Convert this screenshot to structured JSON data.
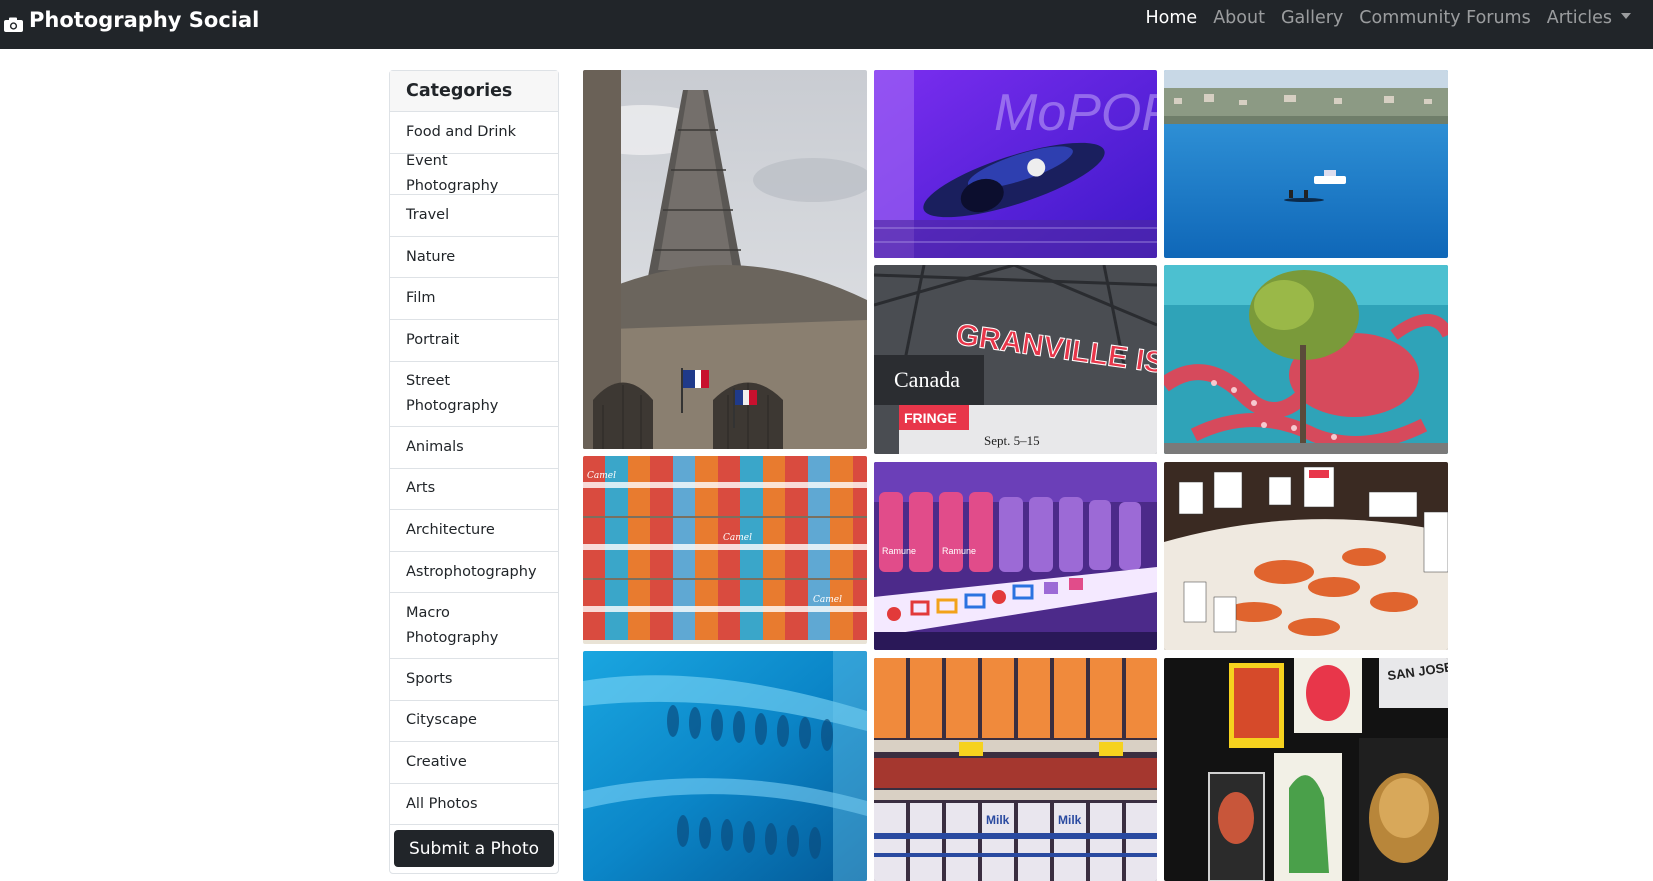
{
  "navbar": {
    "brand": "Photography Social",
    "brand_icon": "camera-icon",
    "links": [
      {
        "label": "Home",
        "active": true
      },
      {
        "label": "About"
      },
      {
        "label": "Gallery"
      },
      {
        "label": "Community Forums"
      },
      {
        "label": "Articles",
        "dropdown": true
      }
    ]
  },
  "sidebar": {
    "title": "Categories",
    "items": [
      {
        "label": "Food and Drink"
      },
      {
        "label": "Event Photography"
      },
      {
        "label": "Travel"
      },
      {
        "label": "Nature"
      },
      {
        "label": "Film"
      },
      {
        "label": "Portrait"
      },
      {
        "label": "Street\nPhotography"
      },
      {
        "label": "Animals"
      },
      {
        "label": "Arts"
      },
      {
        "label": "Architecture"
      },
      {
        "label": "Astrophotography"
      },
      {
        "label": "Macro\nPhotography"
      },
      {
        "label": "Sports"
      },
      {
        "label": "Cityscape"
      },
      {
        "label": "Creative"
      },
      {
        "label": "All Photos"
      }
    ],
    "submit_label": "Submit a Photo"
  },
  "gallery": {
    "photos": [
      {
        "name": "eiffel-tower-photo"
      },
      {
        "name": "futuristic-car-exhibit-photo"
      },
      {
        "name": "lake-rowers-photo"
      },
      {
        "name": "granville-island-sign-photo",
        "sign_text": "GRANVILLE ISLAND",
        "sub_text": "Canada",
        "banner_text": "FRINGE",
        "date_text": "Sept. 5–15"
      },
      {
        "name": "octopus-mural-photo"
      },
      {
        "name": "soup-cans-photo",
        "can_text": "Camel"
      },
      {
        "name": "ramune-bottles-photo",
        "bottle_text": "Ramune"
      },
      {
        "name": "fish-market-photo"
      },
      {
        "name": "aquarium-sculpture-photo"
      },
      {
        "name": "milk-cartons-photo",
        "carton_text": "Milk"
      },
      {
        "name": "comic-posters-photo",
        "sign_text": "SAN JOSE ESTADIO"
      }
    ]
  },
  "colors": {
    "navbar_bg": "#212529",
    "nav_active": "#ffffff",
    "nav_inactive": "rgba(255,255,255,0.55)",
    "sidebar_header_bg": "#f7f7f7",
    "submit_bg": "#212529"
  }
}
